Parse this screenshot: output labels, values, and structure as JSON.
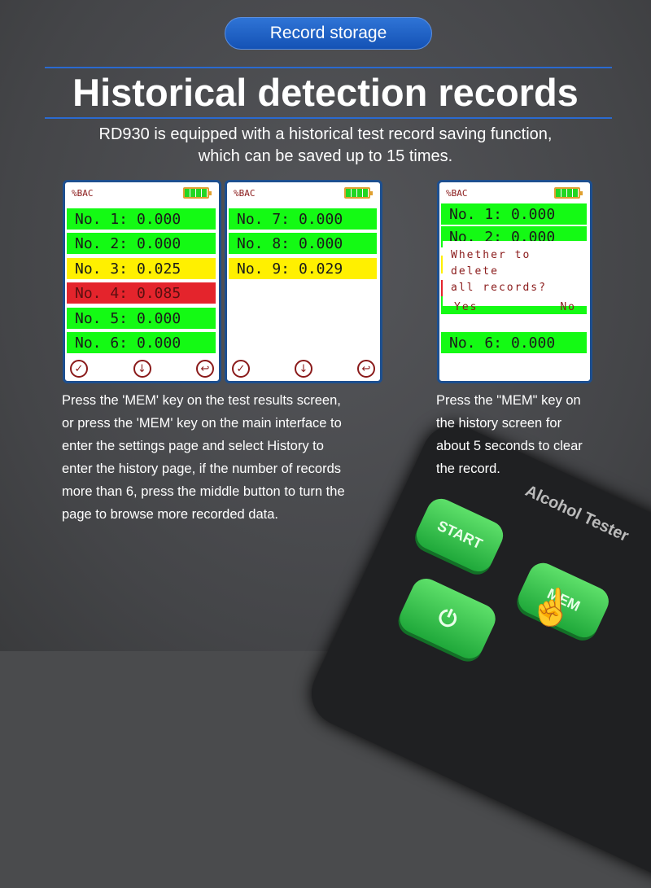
{
  "header": {
    "badge": "Record storage",
    "title": "Historical detection records",
    "subtitle_line1": "RD930 is equipped with a historical test record saving function,",
    "subtitle_line2": "which can be saved up to 15 times."
  },
  "screens": [
    {
      "unit": "%BAC",
      "rows": [
        {
          "label": "No. 1:",
          "value": "0.000",
          "status": "green"
        },
        {
          "label": "No. 2:",
          "value": "0.000",
          "status": "green"
        },
        {
          "label": "No. 3:",
          "value": "0.025",
          "status": "yellow"
        },
        {
          "label": "No. 4:",
          "value": "0.085",
          "status": "red"
        },
        {
          "label": "No. 5:",
          "value": "0.000",
          "status": "green"
        },
        {
          "label": "No. 6:",
          "value": "0.000",
          "status": "green"
        }
      ],
      "icons": [
        "check-icon",
        "arrow-down-icon",
        "return-icon"
      ]
    },
    {
      "unit": "%BAC",
      "rows": [
        {
          "label": "No. 7:",
          "value": "0.000",
          "status": "green"
        },
        {
          "label": "No. 8:",
          "value": "0.000",
          "status": "green"
        },
        {
          "label": "No. 9:",
          "value": "0.029",
          "status": "yellow"
        }
      ],
      "icons": [
        "check-icon",
        "arrow-down-icon",
        "return-icon"
      ]
    },
    {
      "unit": "%BAC",
      "rows": [
        {
          "label": "No. 1:",
          "value": "0.000",
          "status": "green"
        },
        {
          "label": "No. 2:",
          "value": "0.000",
          "status": "green"
        },
        {
          "label": "No. 6:",
          "value": "0.000",
          "status": "green"
        }
      ],
      "dialog": {
        "message_line1": "Whether to delete",
        "message_line2": "all records?",
        "yes": "Yes",
        "no": "No"
      }
    }
  ],
  "descriptions": {
    "left": [
      "Press the 'MEM' key on the test results screen,",
      "or press the 'MEM' key on the main interface to",
      "enter the settings page and select History to",
      "enter the history page, if the number of records",
      "more than 6, press the middle button to turn the",
      "page to browse more recorded data."
    ],
    "right": [
      "Press the \"MEM\" key on",
      "the history screen for",
      "about 5 seconds to clear",
      "the record."
    ]
  },
  "device": {
    "brand": "Alcohol Tester",
    "buttons": {
      "start": "START",
      "mem": "MEM"
    }
  },
  "colors": {
    "accent": "#1f5fc7",
    "green": "#14fa14",
    "yellow": "#fff000",
    "red": "#e4242c"
  }
}
